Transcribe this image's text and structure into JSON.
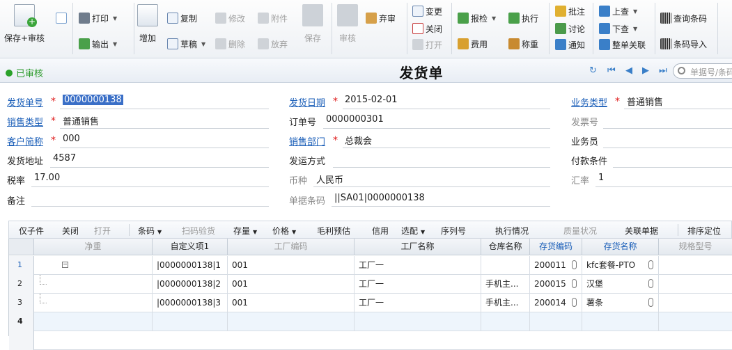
{
  "toolbar": {
    "save_audit": "保存+审核",
    "print": "打印",
    "export": "输出",
    "add": "增加",
    "copy": "复制",
    "draft": "草稿",
    "modify": "修改",
    "delete": "删除",
    "attach": "附件",
    "abandon": "放弃",
    "save": "保存",
    "audit": "审核",
    "discard": "弃审",
    "change": "变更",
    "close": "关闭",
    "open": "打开",
    "report_check": "报检",
    "cost": "费用",
    "execute": "执行",
    "weigh": "称重",
    "annotate": "批注",
    "discuss": "讨论",
    "notify": "通知",
    "prev_query": "上查",
    "next_query": "下查",
    "link_all": "整单关联",
    "barcode_query": "查询条码",
    "barcode_import": "条码导入"
  },
  "header": {
    "status": "已审核",
    "title": "发货单",
    "search_placeholder": "单据号/条码"
  },
  "form": {
    "ship_no_label": "发货单号",
    "ship_no": "0000000138",
    "ship_date_label": "发货日期",
    "ship_date": "2015-02-01",
    "biz_type_label": "业务类型",
    "biz_type": "普通销售",
    "sales_type_label": "销售类型",
    "sales_type": "普通销售",
    "order_no_label": "订单号",
    "order_no": "0000000301",
    "invoice_no_label": "发票号",
    "customer_label": "客户简称",
    "customer": "000",
    "dept_label": "销售部门",
    "dept": "总裁会",
    "salesman_label": "业务员",
    "address_label": "发货地址",
    "address": "4587",
    "ship_method_label": "发运方式",
    "payment_label": "付款条件",
    "tax_label": "税率",
    "tax": "17.00",
    "currency_label": "币种",
    "currency": "人民币",
    "rate_label": "汇率",
    "rate": "1",
    "remark_label": "备注",
    "barcode_label": "单据条码",
    "barcode": "||SA01|0000000138"
  },
  "subbar": [
    "仅子件",
    "关闭",
    "打开",
    "条码",
    "扫码验货",
    "存量",
    "价格",
    "毛利预估",
    "信用",
    "选配",
    "序列号",
    "执行情况",
    "质量状况",
    "关联单据",
    "排序定位"
  ],
  "columns": [
    "净重",
    "自定义项1",
    "工厂编码",
    "工厂名称",
    "仓库名称",
    "存货编码",
    "存货名称",
    "规格型号"
  ],
  "rows": [
    {
      "no": "1",
      "custom": "|0000000138|1",
      "fcode": "001",
      "fname": "工厂一",
      "wh": "",
      "icode": "200011",
      "iname": "kfc套餐-PTO"
    },
    {
      "no": "2",
      "custom": "|0000000138|2",
      "fcode": "001",
      "fname": "工厂一",
      "wh": "手机主...",
      "icode": "200015",
      "iname": "汉堡"
    },
    {
      "no": "3",
      "custom": "|0000000138|3",
      "fcode": "001",
      "fname": "工厂一",
      "wh": "手机主...",
      "icode": "200014",
      "iname": "薯条"
    },
    {
      "no": "4",
      "custom": "",
      "fcode": "",
      "fname": "",
      "wh": "",
      "icode": "",
      "iname": ""
    }
  ]
}
